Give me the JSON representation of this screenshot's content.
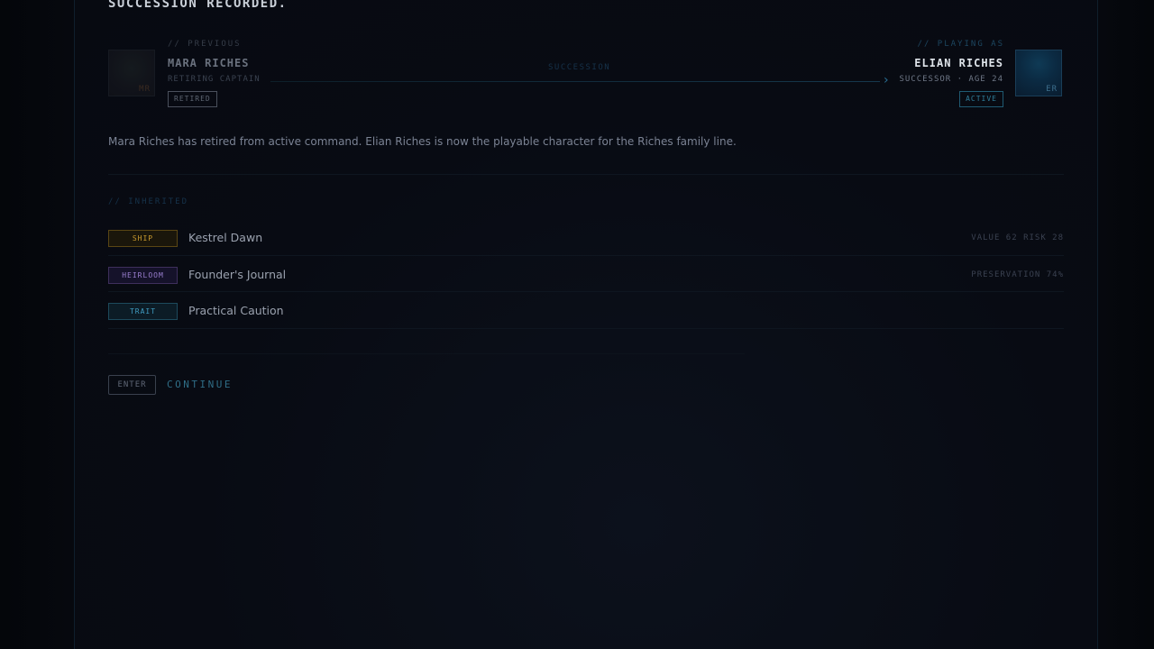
{
  "header": {
    "title": "SUCCESSION RECORDED."
  },
  "previous": {
    "section_label": "// PREVIOUS",
    "name": "MARA RICHES",
    "role": "RETIRING CAPTAIN",
    "status": "RETIRED",
    "initials": "MR"
  },
  "succession_label": "SUCCESSION",
  "current": {
    "section_label": "// PLAYING AS",
    "name": "ELIAN RICHES",
    "role": "SUCCESSOR · AGE 24",
    "status": "ACTIVE",
    "initials": "ER"
  },
  "description": "Mara Riches has retired from active command. Elian Riches is now the playable character for the Riches family line.",
  "inherited": {
    "section_label": "// INHERITED",
    "items": [
      {
        "type": "SHIP",
        "name": "Kestrel Dawn",
        "meta": "VALUE 62 RISK 28",
        "color": "#c99a2e"
      },
      {
        "type": "HEIRLOOM",
        "name": "Founder's Journal",
        "meta": "PRESERVATION 74%",
        "color": "#9b7fd0"
      },
      {
        "type": "TRAIT",
        "name": "Practical Caution",
        "meta": "",
        "color": "#3f9bc0"
      }
    ]
  },
  "actions": {
    "key": "ENTER",
    "label": "CONTINUE"
  },
  "colors": {
    "accent": "#2f6d86",
    "ship": "#c99a2e",
    "heirloom": "#9b7fd0",
    "trait": "#3f9bc0"
  }
}
